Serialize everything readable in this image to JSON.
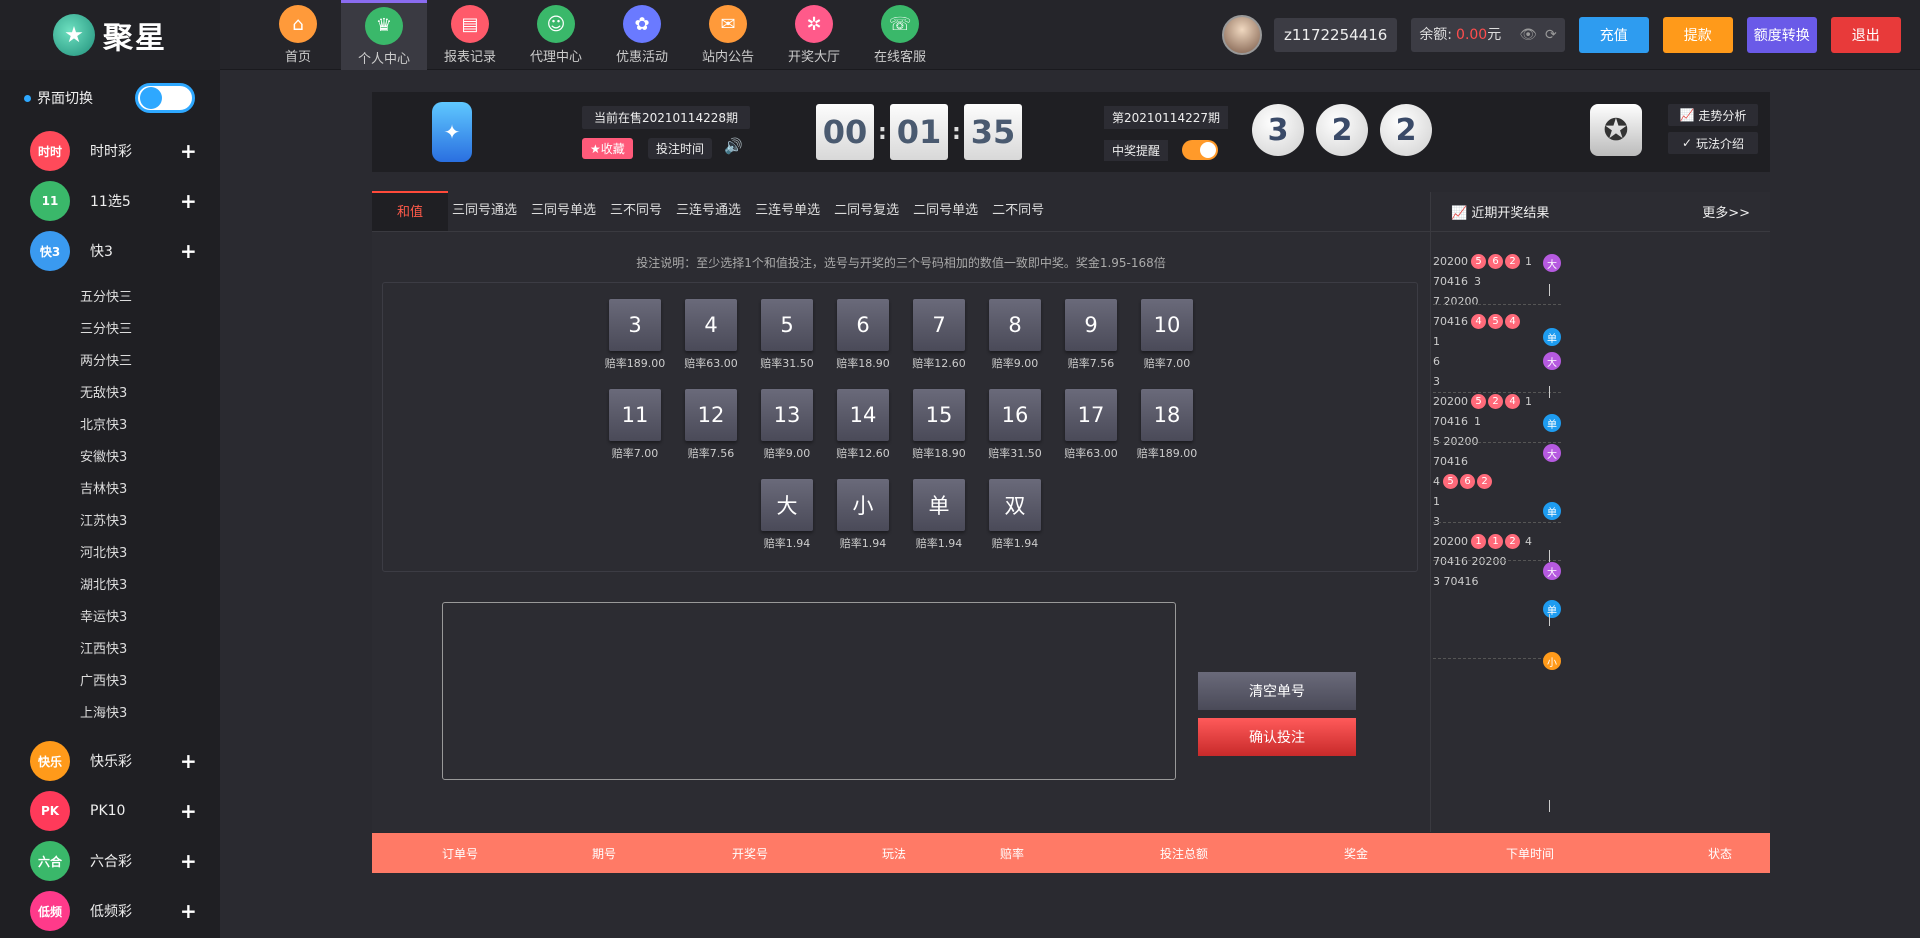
{
  "brand": {
    "logo_text": "聚星"
  },
  "nav": [
    {
      "label": "首页",
      "color": "#ff9a3a",
      "icon": "home-icon"
    },
    {
      "label": "个人中心",
      "color": "#3ab86a",
      "icon": "crown-icon"
    },
    {
      "label": "报表记录",
      "color": "#ff5a6a",
      "icon": "report-icon"
    },
    {
      "label": "代理中心",
      "color": "#3ab86a",
      "icon": "agent-icon"
    },
    {
      "label": "优惠活动",
      "color": "#6a7aff",
      "icon": "gift-icon"
    },
    {
      "label": "站内公告",
      "color": "#ff9a3a",
      "icon": "mail-icon"
    },
    {
      "label": "开奖大厅",
      "color": "#ff5a8a",
      "icon": "lottery-icon"
    },
    {
      "label": "在线客服",
      "color": "#3ab86a",
      "icon": "service-icon"
    }
  ],
  "user": {
    "name": "z1172254416",
    "balance_label": "余额:",
    "balance": "0.00",
    "unit": "元"
  },
  "topbtns": [
    {
      "label": "充值",
      "color": "#2e9cf0"
    },
    {
      "label": "提款",
      "color": "#ff9a1a"
    },
    {
      "label": "额度转换",
      "color": "#6a5ae8"
    },
    {
      "label": "退出",
      "color": "#e83a3a"
    }
  ],
  "sidebar": {
    "switch_label": "界面切换",
    "cats_top": [
      {
        "label": "时时彩",
        "color": "#ff4a5a",
        "short": "时时"
      },
      {
        "label": "11选5",
        "color": "#3ab86a",
        "short": "11"
      },
      {
        "label": "快3",
        "color": "#3a9af0",
        "short": "快3"
      }
    ],
    "subs": [
      "五分快三",
      "三分快三",
      "两分快三",
      "无敌快3",
      "北京快3",
      "安徽快3",
      "吉林快3",
      "江苏快3",
      "河北快3",
      "湖北快3",
      "幸运快3",
      "江西快3",
      "广西快3",
      "上海快3"
    ],
    "cats_bottom": [
      {
        "label": "快乐彩",
        "color": "#ff9a1a",
        "short": "快乐"
      },
      {
        "label": "PK10",
        "color": "#ff3a5a",
        "short": "PK"
      },
      {
        "label": "六合彩",
        "color": "#3ab86a",
        "short": "六合"
      },
      {
        "label": "低频彩",
        "color": "#ff3a8a",
        "short": "低频"
      }
    ]
  },
  "game": {
    "current": "当前在售20210114228期",
    "fav": "★收藏",
    "bettime": "投注时间",
    "countdown": [
      "00",
      "01",
      "35"
    ],
    "prev": "第20210114227期",
    "remind": "中奖提醒",
    "balls": [
      "3",
      "2",
      "2"
    ],
    "trend": "走势分析",
    "rules": "玩法介绍"
  },
  "tabs": [
    "和值",
    "三同号通选",
    "三同号单选",
    "三不同号",
    "三连号通选",
    "三连号单选",
    "二同号复选",
    "二同号单选",
    "二不同号"
  ],
  "hint": "投注说明：至少选择1个和值投注，选号与开奖的三个号码相加的数值一致即中奖。奖金1.95-168倍",
  "numbers": [
    {
      "n": "3",
      "odds": "赔率189.00"
    },
    {
      "n": "4",
      "odds": "赔率63.00"
    },
    {
      "n": "5",
      "odds": "赔率31.50"
    },
    {
      "n": "6",
      "odds": "赔率18.90"
    },
    {
      "n": "7",
      "odds": "赔率12.60"
    },
    {
      "n": "8",
      "odds": "赔率9.00"
    },
    {
      "n": "9",
      "odds": "赔率7.56"
    },
    {
      "n": "10",
      "odds": "赔率7.00"
    },
    {
      "n": "11",
      "odds": "赔率7.00"
    },
    {
      "n": "12",
      "odds": "赔率7.56"
    },
    {
      "n": "13",
      "odds": "赔率9.00"
    },
    {
      "n": "14",
      "odds": "赔率12.60"
    },
    {
      "n": "15",
      "odds": "赔率18.90"
    },
    {
      "n": "16",
      "odds": "赔率31.50"
    },
    {
      "n": "17",
      "odds": "赔率63.00"
    },
    {
      "n": "18",
      "odds": "赔率189.00"
    },
    {
      "n": "大",
      "odds": "赔率1.94"
    },
    {
      "n": "小",
      "odds": "赔率1.94"
    },
    {
      "n": "单",
      "odds": "赔率1.94"
    },
    {
      "n": "双",
      "odds": "赔率1.94"
    }
  ],
  "actions": {
    "clear": "清空单号",
    "confirm": "确认投注"
  },
  "results": {
    "title": "近期开奖结果",
    "more": "更多>>"
  },
  "results_rows": [
    {
      "text": "20200",
      "balls": [
        "5",
        "6",
        "2"
      ],
      "tail": "1"
    },
    {
      "text": "70416",
      "balls": [],
      "tail": "3"
    },
    {
      "text": "7 20200",
      "balls": [],
      "tail": ""
    },
    {
      "text": "70416",
      "balls": [
        "4",
        "5",
        "4"
      ],
      "tail": ""
    },
    {
      "text": "1",
      "balls": [],
      "tail": ""
    },
    {
      "text": "6",
      "balls": [],
      "tail": ""
    },
    {
      "text": "3",
      "balls": [],
      "tail": ""
    },
    {
      "text": "20200",
      "balls": [
        "5",
        "2",
        "4"
      ],
      "tail": "1"
    },
    {
      "text": "70416",
      "balls": [],
      "tail": "1"
    },
    {
      "text": "5 20200",
      "balls": [],
      "tail": ""
    },
    {
      "text": "70416",
      "balls": [],
      "tail": ""
    },
    {
      "text": "4",
      "balls": [
        "5",
        "6",
        "2"
      ],
      "tail": ""
    },
    {
      "text": "1",
      "balls": [],
      "tail": ""
    },
    {
      "text": "3",
      "balls": [],
      "tail": ""
    },
    {
      "text": "20200",
      "balls": [
        "1",
        "1",
        "2"
      ],
      "tail": "4"
    },
    {
      "text": "70416 20200",
      "balls": [],
      "tail": ""
    },
    {
      "text": "3 70416",
      "balls": [],
      "tail": ""
    }
  ],
  "result_tags": [
    {
      "t": "大",
      "c": "#b65ae0"
    },
    {
      "t": "单",
      "c": "#1e9cf0"
    },
    {
      "t": "大",
      "c": "#b65ae0"
    },
    {
      "t": "单",
      "c": "#1e9cf0"
    },
    {
      "t": "大",
      "c": "#b65ae0"
    },
    {
      "t": "单",
      "c": "#1e9cf0"
    },
    {
      "t": "大",
      "c": "#b65ae0"
    },
    {
      "t": "单",
      "c": "#1e9cf0"
    },
    {
      "t": "小",
      "c": "#ff9a1a"
    }
  ],
  "table_headers": [
    "订单号",
    "期号",
    "开奖号",
    "玩法",
    "赔率",
    "投注总额",
    "奖金",
    "下单时间",
    "状态"
  ]
}
